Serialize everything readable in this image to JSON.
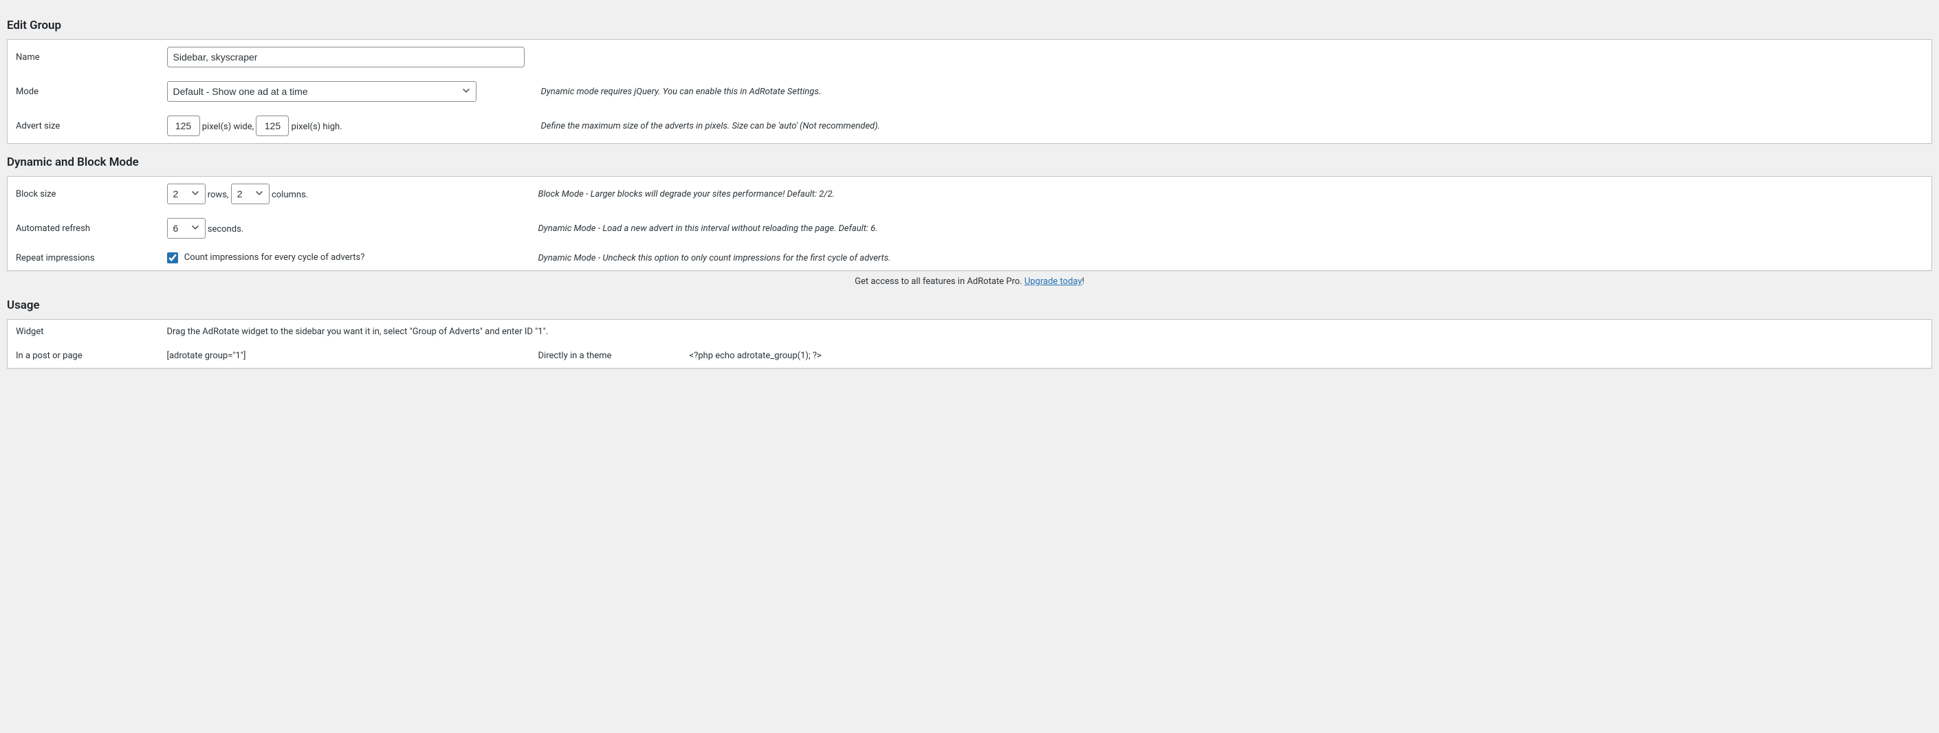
{
  "section1": {
    "heading": "Edit Group",
    "name_label": "Name",
    "name_value": "Sidebar, skyscraper",
    "mode_label": "Mode",
    "mode_value": "Default - Show one ad at a time",
    "mode_desc": "Dynamic mode requires jQuery. You can enable this in AdRotate Settings.",
    "size_label": "Advert size",
    "size_width": "125",
    "size_width_suffix": "pixel(s) wide,",
    "size_height": "125",
    "size_height_suffix": "pixel(s) high.",
    "size_desc": "Define the maximum size of the adverts in pixels. Size can be 'auto' (Not recommended)."
  },
  "section2": {
    "heading": "Dynamic and Block Mode",
    "block_label": "Block size",
    "block_rows": "2",
    "block_rows_suffix": "rows,",
    "block_cols": "2",
    "block_cols_suffix": "columns.",
    "block_desc": "Block Mode - Larger blocks will degrade your sites performance! Default: 2/2.",
    "refresh_label": "Automated refresh",
    "refresh_value": "6",
    "refresh_suffix": "seconds.",
    "refresh_desc": "Dynamic Mode - Load a new advert in this interval without reloading the page. Default: 6.",
    "repeat_label": "Repeat impressions",
    "repeat_text": "Count impressions for every cycle of adverts?",
    "repeat_desc": "Dynamic Mode - Uncheck this option to only count impressions for the first cycle of adverts."
  },
  "upgrade": {
    "prefix": "Get access to all features in AdRotate Pro. ",
    "link": "Upgrade today",
    "suffix": "!"
  },
  "section3": {
    "heading": "Usage",
    "widget_label": "Widget",
    "widget_text": "Drag the AdRotate widget to the sidebar you want it in, select \"Group of Adverts\" and enter ID \"1\".",
    "post_label": "In a post or page",
    "post_code": "[adrotate group=\"1\"]",
    "theme_label": "Directly in a theme",
    "theme_code": "<?php echo adrotate_group(1); ?>"
  }
}
